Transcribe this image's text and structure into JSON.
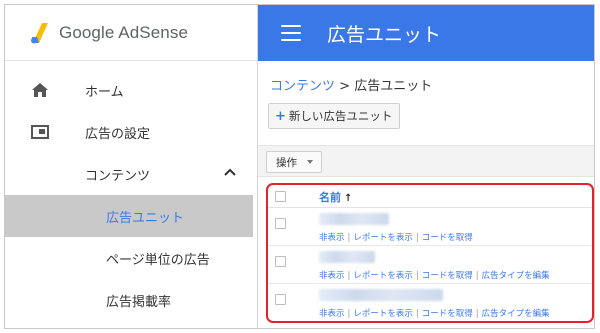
{
  "brand": {
    "name": "Google AdSense"
  },
  "header": {
    "title": "広告ユニット"
  },
  "sidebar": {
    "items": [
      {
        "label": "ホーム",
        "icon": "home-icon"
      },
      {
        "label": "広告の設定",
        "icon": "ad-settings-icon"
      },
      {
        "label": "コンテンツ",
        "icon": "chevron-up-icon"
      },
      {
        "label": "広告ユニット"
      },
      {
        "label": "ページ単位の広告"
      },
      {
        "label": "広告掲載率"
      }
    ]
  },
  "breadcrumb": {
    "parent": "コンテンツ",
    "separator": " > ",
    "current": "広告ユニット"
  },
  "toolbar": {
    "new_unit_label": "新しい広告ユニット",
    "new_unit_plus": "+",
    "operations_label": "操作"
  },
  "table": {
    "header_name": "名前",
    "sort_indicator": "↑",
    "rows": [
      {
        "actions": [
          "非表示",
          "レポートを表示",
          "コードを取得"
        ]
      },
      {
        "actions": [
          "非表示",
          "レポートを表示",
          "コードを取得",
          "広告タイプを編集"
        ]
      },
      {
        "actions": [
          "非表示",
          "レポートを表示",
          "コードを取得",
          "広告タイプを編集"
        ]
      }
    ],
    "action_separator": "|"
  },
  "colors": {
    "accent": "#3b78e7",
    "highlight_border": "#e0222a",
    "active_nav_bg": "#c9c9c9"
  }
}
